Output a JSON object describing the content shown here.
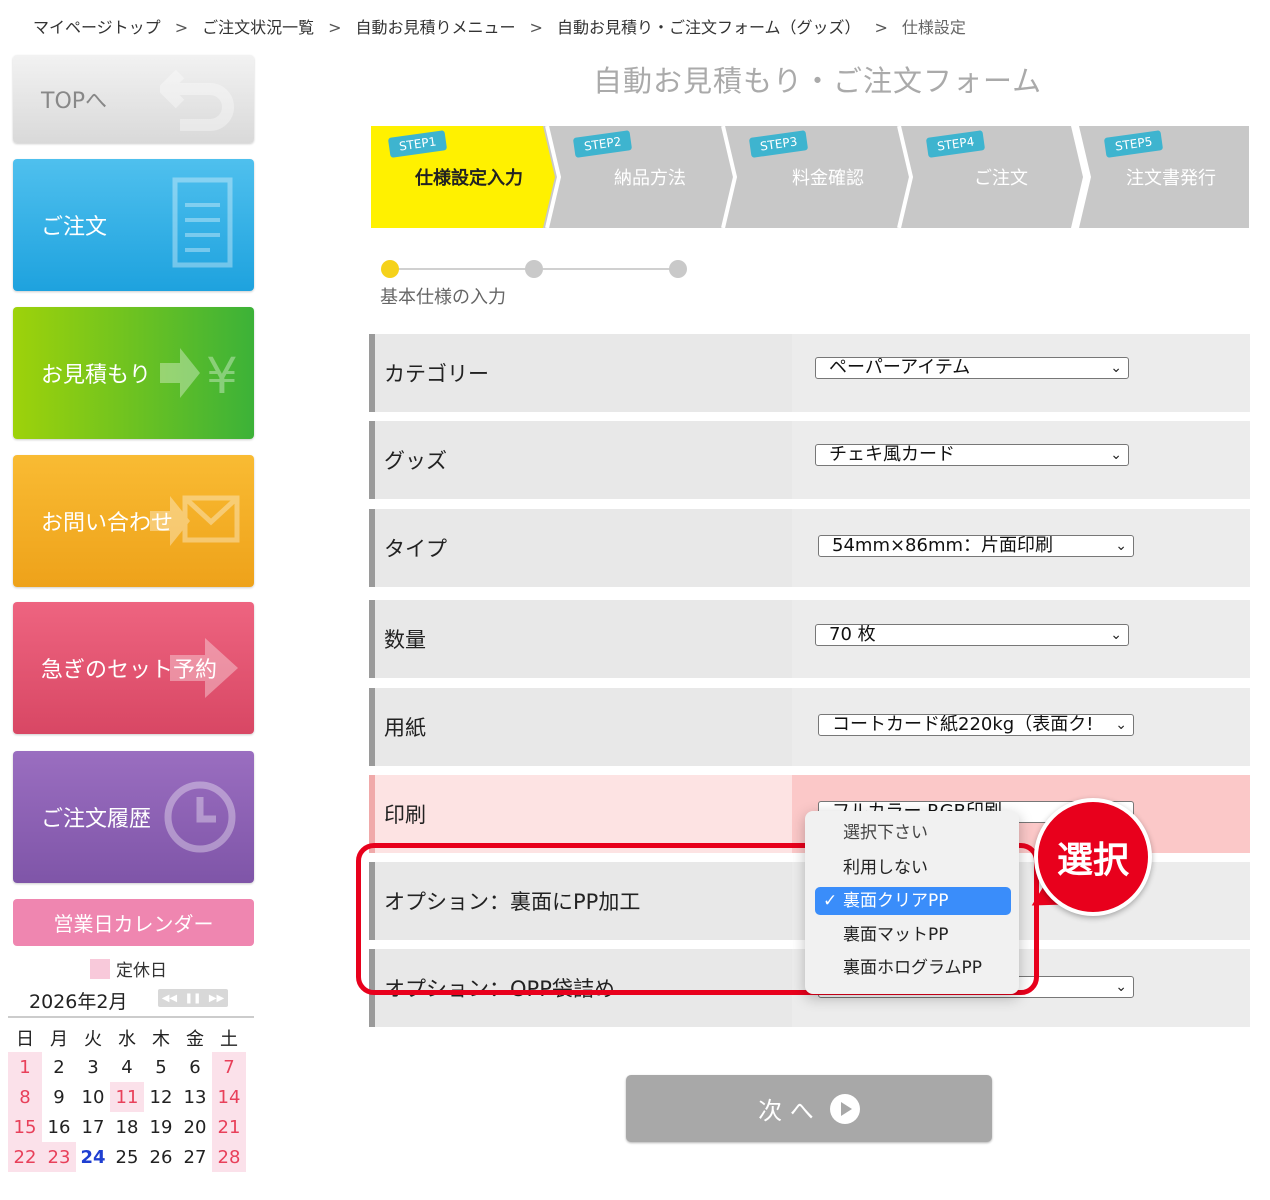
{
  "breadcrumb": {
    "items": [
      "マイページトップ",
      "ご注文状況一覧",
      "自動お見積りメニュー",
      "自動お見積り・ご注文フォーム（グッズ）",
      "仕様設定"
    ],
    "separator": ">"
  },
  "sidebar": {
    "top": "TOPへ",
    "order": "ご注文",
    "quote": "お見積もり",
    "contact": "お問い合わせ",
    "rush": "急ぎのセット予約",
    "history": "ご注文履歴"
  },
  "calendar": {
    "title": "営業日カレンダー",
    "legend": "定休日",
    "month": "2026年2月",
    "weekdays": [
      "日",
      "月",
      "火",
      "水",
      "木",
      "金",
      "土"
    ],
    "weeks": [
      [
        "1",
        "2",
        "3",
        "4",
        "5",
        "6",
        "7"
      ],
      [
        "8",
        "9",
        "10",
        "11",
        "12",
        "13",
        "14"
      ],
      [
        "15",
        "16",
        "17",
        "18",
        "19",
        "20",
        "21"
      ],
      [
        "22",
        "23",
        "24",
        "25",
        "26",
        "27",
        "28"
      ]
    ]
  },
  "form": {
    "title": "自動お見積もり・ご注文フォーム",
    "steps": [
      {
        "tag": "STEP1",
        "label": "仕様設定入力"
      },
      {
        "tag": "STEP2",
        "label": "納品方法"
      },
      {
        "tag": "STEP3",
        "label": "料金確認"
      },
      {
        "tag": "STEP4",
        "label": "ご注文"
      },
      {
        "tag": "STEP5",
        "label": "注文書発行"
      }
    ],
    "substep_label": "基本仕様の入力",
    "rows": [
      {
        "label": "カテゴリー",
        "value": "ペーパーアイテム"
      },
      {
        "label": "グッズ",
        "value": "チェキ風カード"
      },
      {
        "label": "タイプ",
        "value": "54mm×86mm：片面印刷"
      },
      {
        "label": "数量",
        "value": "70 枚"
      },
      {
        "label": "用紙",
        "value": "コートカード紙220kg（表面ク!"
      },
      {
        "label": "印刷",
        "value": "フルカラー RGB印刷"
      },
      {
        "label": "オプション：裏面にPP加工",
        "value": ""
      },
      {
        "label": "オプション：OPP袋詰め",
        "value": ""
      }
    ],
    "next_button": "次 へ"
  },
  "dropdown": {
    "options": [
      "選択下さい",
      "利用しない",
      "裏面クリアPP",
      "裏面マットPP",
      "裏面ホログラムPP"
    ],
    "selected": "裏面クリアPP"
  },
  "annotation": {
    "badge": "選択"
  },
  "colors": {
    "active_step": "#fff100",
    "inactive_step": "#c8c8c8",
    "highlight": "#e8001c",
    "selected_option": "#3a8dfa"
  }
}
